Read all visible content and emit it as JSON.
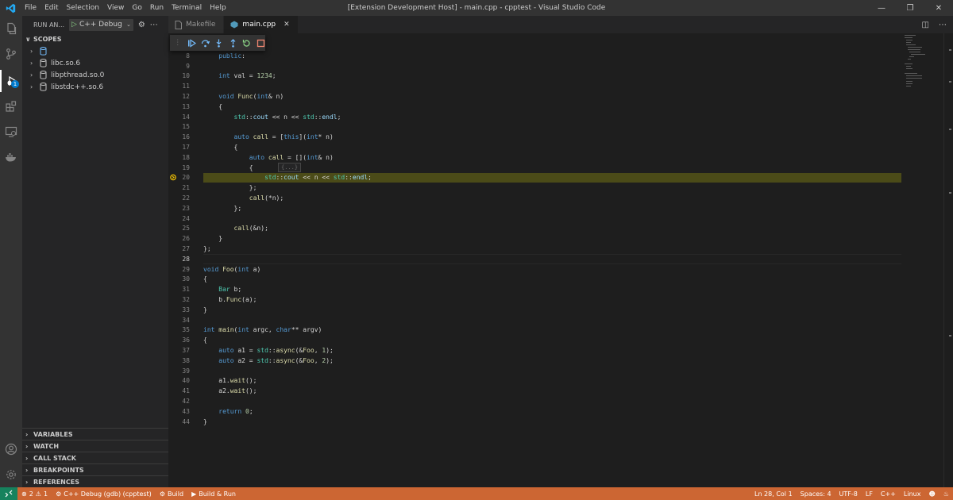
{
  "app": {
    "window_title": "[Extension Development Host] - main.cpp - cpptest - Visual Studio Code",
    "menu": [
      "File",
      "Edit",
      "Selection",
      "View",
      "Go",
      "Run",
      "Terminal",
      "Help"
    ],
    "brand_color": "#007acc"
  },
  "activity_bar": {
    "items": [
      "explorer-icon",
      "source-control-icon",
      "run-debug-icon",
      "extensions-icon",
      "remote-explorer-icon",
      "docker-icon"
    ],
    "debug_badge": "1",
    "bottom": [
      "account-icon",
      "manage-gear-icon"
    ]
  },
  "sidebar": {
    "title": "RUN AN...",
    "config_label": "C++ Debug (g",
    "scopes_header": "SCOPES",
    "scopes": [
      "",
      "libc.so.6",
      "libpthread.so.0",
      "libstdc++.so.6"
    ],
    "sections": [
      "VARIABLES",
      "WATCH",
      "CALL STACK",
      "BREAKPOINTS",
      "REFERENCES"
    ]
  },
  "tabs": [
    {
      "label": "Makefile",
      "active": false
    },
    {
      "label": "main.cpp",
      "active": true
    }
  ],
  "debug_toolbar": [
    "continue",
    "step-over",
    "step-into",
    "step-out",
    "restart",
    "stop"
  ],
  "code": {
    "current_line": "20",
    "cursor_line": "28",
    "fold_hint": "{...}",
    "lines": [
      {
        "n": "8",
        "t": "    public:"
      },
      {
        "n": "9",
        "t": ""
      },
      {
        "n": "10",
        "t": "    int val = 1234;"
      },
      {
        "n": "11",
        "t": ""
      },
      {
        "n": "12",
        "t": "    void Func(int& n)"
      },
      {
        "n": "13",
        "t": "    {"
      },
      {
        "n": "14",
        "t": "        std::cout << n << std::endl;"
      },
      {
        "n": "15",
        "t": ""
      },
      {
        "n": "16",
        "t": "        auto call = [this](int* n)"
      },
      {
        "n": "17",
        "t": "        {"
      },
      {
        "n": "18",
        "t": "            auto call = [](int& n)"
      },
      {
        "n": "19",
        "t": "            {"
      },
      {
        "n": "20",
        "t": "                std::cout << n << std::endl;"
      },
      {
        "n": "21",
        "t": "            };"
      },
      {
        "n": "22",
        "t": "            call(*n);"
      },
      {
        "n": "23",
        "t": "        };"
      },
      {
        "n": "24",
        "t": ""
      },
      {
        "n": "25",
        "t": "        call(&n);"
      },
      {
        "n": "26",
        "t": "    }"
      },
      {
        "n": "27",
        "t": "};"
      },
      {
        "n": "28",
        "t": ""
      },
      {
        "n": "29",
        "t": "void Foo(int a)"
      },
      {
        "n": "30",
        "t": "{"
      },
      {
        "n": "31",
        "t": "    Bar b;"
      },
      {
        "n": "32",
        "t": "    b.Func(a);"
      },
      {
        "n": "33",
        "t": "}"
      },
      {
        "n": "34",
        "t": ""
      },
      {
        "n": "35",
        "t": "int main(int argc, char** argv)"
      },
      {
        "n": "36",
        "t": "{"
      },
      {
        "n": "37",
        "t": "    auto a1 = std::async(&Foo, 1);"
      },
      {
        "n": "38",
        "t": "    auto a2 = std::async(&Foo, 2);"
      },
      {
        "n": "39",
        "t": ""
      },
      {
        "n": "40",
        "t": "    a1.wait();"
      },
      {
        "n": "41",
        "t": "    a2.wait();"
      },
      {
        "n": "42",
        "t": ""
      },
      {
        "n": "43",
        "t": "    return 0;"
      },
      {
        "n": "44",
        "t": "}"
      }
    ]
  },
  "statusbar": {
    "problems": "2",
    "warnings": "1",
    "debug_config": "C++ Debug (gdb) (cpptest)",
    "build": "Build",
    "build_run": "Build & Run",
    "position": "Ln 28, Col 1",
    "spaces": "Spaces: 4",
    "encoding": "UTF-8",
    "eol": "LF",
    "language": "C++",
    "platform": "Linux",
    "color": "#cc6633",
    "remote_color": "#16825d"
  }
}
